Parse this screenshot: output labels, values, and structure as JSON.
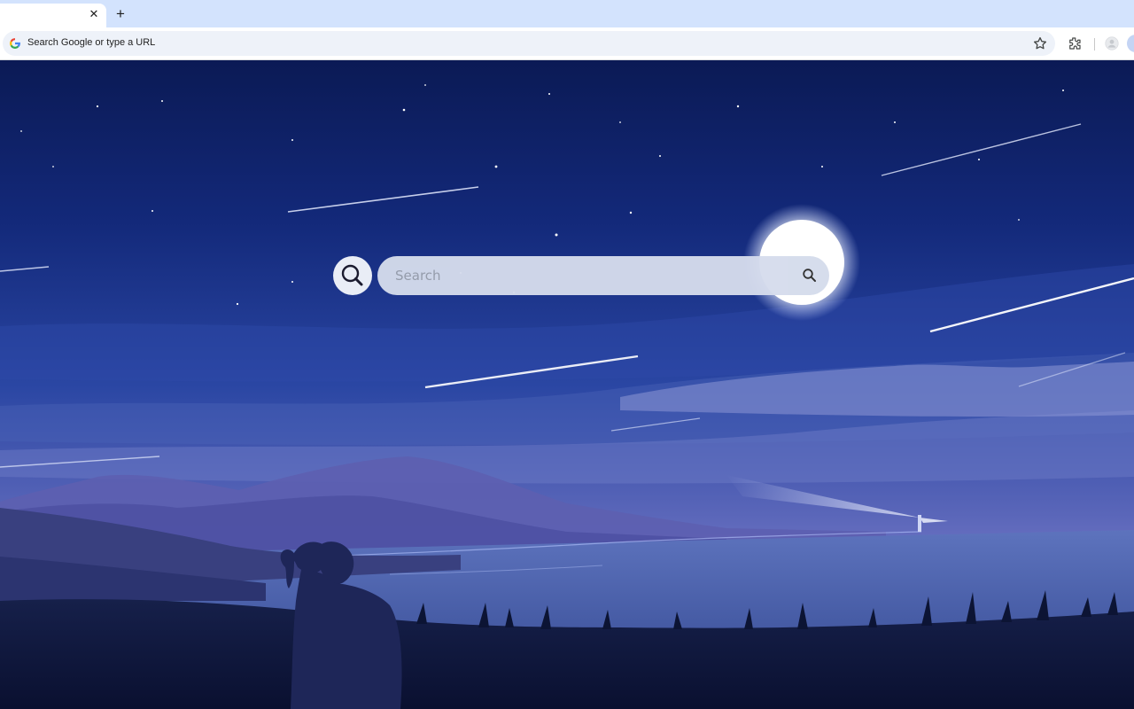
{
  "browser": {
    "tab": {
      "close_glyph": "✕"
    },
    "new_tab_glyph": "+",
    "omnibox": {
      "placeholder": "Search Google or type a URL"
    },
    "icons": [
      "google-g-icon",
      "star-icon",
      "extensions-icon",
      "profile-icon"
    ]
  },
  "page": {
    "search": {
      "placeholder": "Search"
    },
    "icons": [
      "magnifier-logo-icon",
      "search-icon"
    ]
  }
}
